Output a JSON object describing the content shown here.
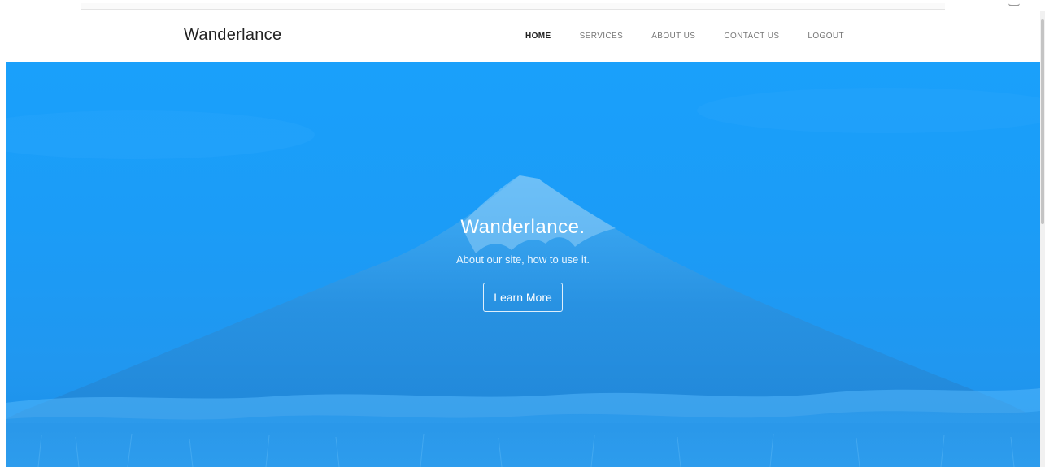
{
  "navbar": {
    "brand": "Wanderlance",
    "items": [
      {
        "label": "HOME",
        "active": true
      },
      {
        "label": "SERVICES",
        "active": false
      },
      {
        "label": "ABOUT US",
        "active": false
      },
      {
        "label": "CONTACT US",
        "active": false
      },
      {
        "label": "LOGOUT",
        "active": false
      }
    ]
  },
  "hero": {
    "title": "Wanderlance.",
    "subtitle": "About our site, how to use it.",
    "button_label": "Learn More",
    "overlay_color": "#1a9cf8"
  }
}
